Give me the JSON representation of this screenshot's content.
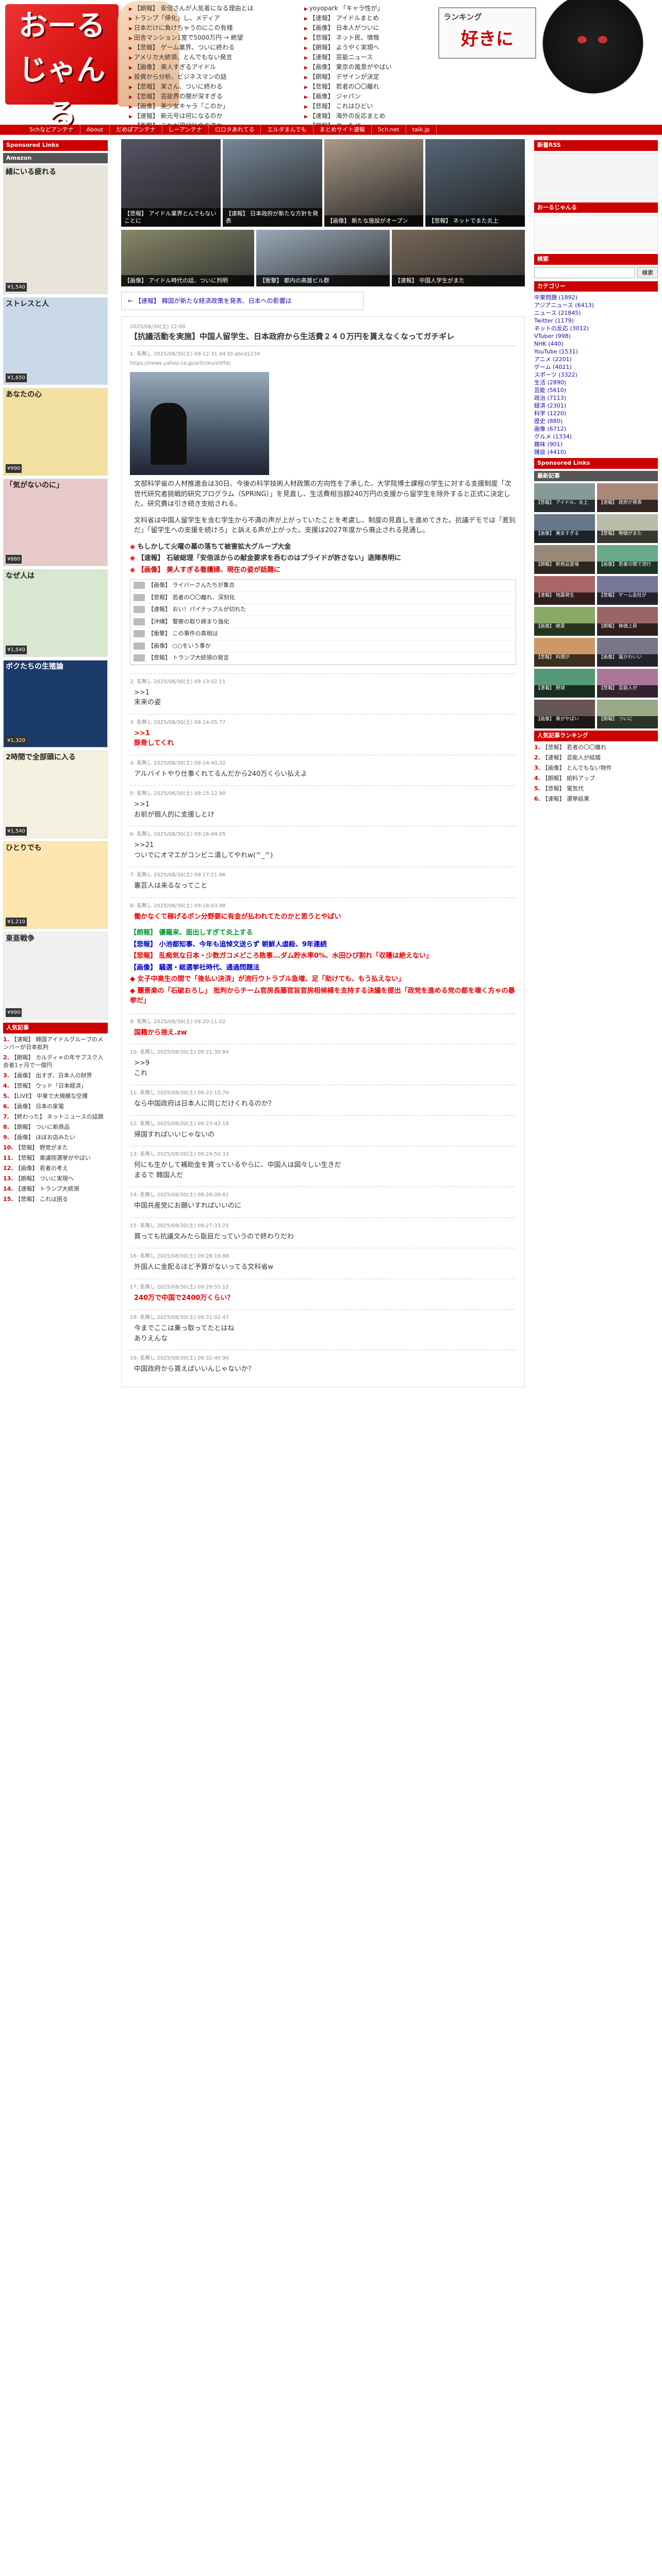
{
  "site": {
    "logo_line1": "おーる",
    "logo_line2": "じゃんる",
    "banner_title": "ランキング",
    "banner_sub": "好きに",
    "headlines": [
      "【朗報】 安倍さんが人気者になる理由とは",
      "トランプ「帰化」し、メディア",
      "日本だけに負けちゃうのにこの有様",
      "田舎マンション1室で5000万円 → 絶望",
      "【悲報】 ゲーム業界、ついに終わる",
      "アメリカ大統領、とんでもない発言",
      "【画像】 美人すぎるアイドル",
      "投資から分析、ビジネスマンの話",
      "【悲報】 某さん、ついに終わる",
      "【悲報】 芸能界の闇が深すぎる",
      "【画像】 美少女キャラ「このか」",
      "【速報】 新元号は何になるのか",
      "【衝撃】 これが現代社会の姿か"
    ],
    "headlines2": [
      "yoyopark 「キャラ性が」",
      "【速報】 アイドルまとめ",
      "【画像】 日本人がついに",
      "【悲報】 ネット民、憤慨",
      "【朗報】 ようやく実現へ",
      "【速報】 芸能ニュース",
      "【画像】 東京の風景がやばい",
      "【朗報】 デザインが決定",
      "【悲報】 若者の〇〇離れ",
      "【画像】 ジャパン",
      "【悲報】 これはひどい",
      "【速報】 海外の反応まとめ",
      "【朗報】 やったぜ"
    ],
    "nav": [
      "5chなどアンテナ",
      "About",
      "だめぽアンテナ",
      "しーアンテナ",
      "ロロタあれてる",
      "エルダまんでも",
      "まとめサイト速報",
      "5ch.net",
      "talk.jp"
    ]
  },
  "left": {
    "ads_heading": "Sponsored Links",
    "amazon_heading": "Amazon",
    "ads": [
      {
        "title": "緒にいる疲れる",
        "price": "¥1,540"
      },
      {
        "title": "ストレスと人",
        "price": "¥1,650"
      },
      {
        "title": "あなたの心",
        "price": "¥990"
      },
      {
        "title": "「気がないのに」",
        "price": "¥880"
      },
      {
        "title": "なぜ人は",
        "price": "¥1,540"
      },
      {
        "title": "ボクたちの生殖論",
        "price": "¥1,320"
      },
      {
        "title": "2時間で全部頭に入る",
        "price": "¥1,540"
      },
      {
        "title": "ひとりでも",
        "price": "¥1,210"
      },
      {
        "title": "東亜戦争",
        "price": "¥990"
      }
    ],
    "ranking_heading": "人気記事",
    "ranking": [
      "【速報】 韓国アイドルグループのメンバーが日本批判",
      "【朗報】 カルディャの年サブスク入会者1ヶ月で一億円",
      "【画像】 出すぎ、日本人の財界",
      "【悲報】 ウッド「日本経済」",
      "【LIVE】 中東で大規模な空爆",
      "【画像】 日本の家電",
      "【終わった】 ネットニュースの話題",
      "【朗報】 ついに新商品",
      "【画像】 ほぼお店みたい",
      "【悲報】 野党がまた",
      "【悲報】 衆議院選挙がやばい",
      "【画像】 若者の考え",
      "【朗報】 ついに実現へ",
      "【速報】 トランプ大統領",
      "【悲報】 これは困る"
    ]
  },
  "main": {
    "features": [
      "【悲報】 アイドル業界とんでもないことに",
      "【速報】 日本政府が新たな方針を発表",
      "【画像】 新たな施設がオープン",
      "【悲報】 ネットでまた炎上"
    ],
    "features2": [
      "【画像】 アイドル時代の話、ついに判明",
      "【衝撃】 都内の高層ビル群",
      "【速報】 中国人学生がまた"
    ],
    "prev_link": "← 【速報】 韓国が新たな経済政策を発表、日本への影響は",
    "article": {
      "date": "2025/08/30(土) 12:00",
      "title": "【抗議活動を実施】中国人留学生、日本政府から生活費２４０万円を貰えなくなってガチギレ",
      "op_meta": "1: 名無し 2025/08/30(土) 09:12:31.44 ID:abcd1234",
      "op_url": "https://news.yahoo.co.jp/articles/e0ffdc",
      "op_body1": "文部科学省の人材推進会は30日、今後の科学技術人材政策の方向性を了承した。大学院博士課程の学生に対する支援制度「次世代研究者挑戦的研究プログラム（SPRING）」を見直し、生活費相当額240万円の支援から留学生を除外すると正式に決定した。研究費は引き続き支給される。",
      "op_body2": "文科省は中国人留学生を含む学生から不満の声が上がっていたことを考慮し、制度の見直しを進めてきた。抗議デモでは「差別だ」「留学生への支援を続けろ」と訴える声が上がった。支援は2027年度から廃止される見通し。",
      "related": [
        {
          "mark": "◆",
          "text": "もしかして火曜の墓の落ちて被害拡大グループ大金"
        },
        {
          "mark": "◆",
          "text": "【速報】 石破総理「安倍派からの献金要求を呑むのはプライドが許さない」退陣表明に"
        },
        {
          "mark": "◆",
          "text": "【画像】 美人すぎる看護婦、現在の姿が話題に"
        }
      ],
      "rel_list": [
        "【画像】 ライバーさんたちが集合",
        "【悲報】 若者の〇〇離れ、深刻化",
        "【速報】 おい！パイナップルが切れた",
        "【沖縄】 警察の取り締まり強化",
        "【衝撃】 この事件の真相は",
        "【画像】 ○○をいう事か",
        "【悲報】 トランプ大統領の発言"
      ],
      "responses": [
        {
          "meta": "2: 名無し 2025/08/30(土) 09:13:02.11",
          "body": ">>1\n末来の姿",
          "style": ""
        },
        {
          "meta": "3: 名無し 2025/08/30(土) 09:14:05.77",
          "body": ">>1\n豚骨してくれ",
          "style": "red"
        },
        {
          "meta": "4: 名無し 2025/08/30(土) 09:14:40.32",
          "body": "アルバイトやり仕事くれてるんだから240万くらい払えよ",
          "style": ""
        },
        {
          "meta": "5: 名無し 2025/08/30(土) 09:15:12.90",
          "body": ">>1\nお前が個人的に支援しとけ",
          "style": ""
        },
        {
          "meta": "6: 名無し 2025/08/30(土) 09:16:44.05",
          "body": ">>21\nついでにオマエがコンビニ潰してやれw(^_^)",
          "style": ""
        },
        {
          "meta": "7: 名無し 2025/08/30(土) 09:17:21.66",
          "body": "裏芸人は来るなってこと",
          "style": ""
        },
        {
          "meta": "8: 名無し 2025/08/30(土) 09:18:03.48",
          "body": "働かなくて稼げるボン分野要に有金が払われてたのかと思うとやばい",
          "style": "red"
        }
      ],
      "breaking": [
        {
          "tag": "【朗報】",
          "text": "優羅来、面出しすぎて炎上する",
          "style": "green"
        },
        {
          "tag": "【悲報】",
          "text": "小池都知事、今年も追悼文送らず 朝鮮人虐殺、9年連続",
          "style": "blue"
        },
        {
          "tag": "【悲報】",
          "text": "乱痴気な日本・少数ガコメどころ敗事...ダム貯水率0%、水田ひび割れ「収穫は絶えない」",
          "style": "red"
        },
        {
          "tag": "【画像】",
          "text": "騒選・総選挙社時代、通過問題法",
          "style": "blue"
        },
        {
          "tag": "◆",
          "text": "女子中高生の間で「後払い決済」が流行ウトラブル急増、足「助けても、もう払えない」",
          "style": "red"
        },
        {
          "tag": "◆",
          "text": "麗景楽の「石破おろし」 批判からチーム官房長藤官旨官房相候補を支持する決議を提出「政党を進める党の都を壊く方ゃの暴挙だ」",
          "style": "red"
        }
      ],
      "responses2": [
        {
          "meta": "9: 名無し 2025/08/30(土) 09:20:11.02",
          "body": "国籍から捨え.zw",
          "style": "red"
        },
        {
          "meta": "10: 名無し 2025/08/30(土) 09:21:30.84",
          "body": ">>9\nこれ",
          "style": ""
        },
        {
          "meta": "11: 名無し 2025/08/30(土) 09:22:15.70",
          "body": "なら中国政府は日本人に同じだけくれるのか？",
          "style": ""
        },
        {
          "meta": "12: 名無し 2025/08/30(土) 09:23:42.18",
          "body": "帰国すればいいじゃないの",
          "style": ""
        },
        {
          "meta": "13: 名無し 2025/08/30(土) 09:24:50.33",
          "body": "何にも生かして補助金を貰っているやらに、中国人は図々しい生きだ\nまるで 韓国人だ",
          "style": ""
        },
        {
          "meta": "14: 名無し 2025/08/30(土) 09:26:09.61",
          "body": "中国共産党にお願いすればいいのに",
          "style": ""
        },
        {
          "meta": "15: 名無し 2025/08/30(土) 09:27:33.25",
          "body": "貰っても抗議文みたら翫目だっていうので終わりだわ",
          "style": ""
        },
        {
          "meta": "16: 名無し 2025/08/30(土) 09:28:19.88",
          "body": "外国人に金配るほど予算がないってる文科省w",
          "style": ""
        },
        {
          "meta": "17: 名無し 2025/08/30(土) 09:29:55.12",
          "body": "240万で中国で2400万くらい？",
          "style": "red"
        },
        {
          "meta": "18: 名無し 2025/08/30(土) 09:31:02.47",
          "body": "今までここは乗っ取ってたとはね\nありえんな",
          "style": ""
        },
        {
          "meta": "19: 名無し 2025/08/30(土) 09:32:40.90",
          "body": "中国政府から貰えばいいんじゃないか？",
          "style": ""
        }
      ]
    }
  },
  "right": {
    "rss_heading": "新着RSS",
    "profile_heading": "おーるじゃんる",
    "search_heading": "検索",
    "search_placeholder": "",
    "search_button": "検索",
    "archive_heading": "カテゴリー",
    "categories": [
      "中東問題 (1892)",
      "アジアニュース (6413)",
      "ニュース (21845)",
      "Twitter (1179)",
      "ネットの反応 (3012)",
      "VTuber (998)",
      "NHK (440)",
      "YouTube (1531)",
      "アニメ (2201)",
      "ゲーム (4021)",
      "スポーツ (3322)",
      "生活 (2890)",
      "芸能 (5610)",
      "政治 (7113)",
      "経済 (2301)",
      "科学 (1220)",
      "歴史 (880)",
      "画像 (6712)",
      "グルメ (1334)",
      "趣味 (901)",
      "雑談 (4410)"
    ],
    "sponsored_heading": "Sponsored Links",
    "latest_heading": "最新記事",
    "thumbs": [
      "【悲報】 アイドル、炎上",
      "【速報】 政府が発表",
      "【画像】 美女すぎる",
      "【悲報】 物価がまた",
      "【朗報】 新商品登場",
      "【画像】 若者の間で流行",
      "【速報】 地震発生",
      "【悲報】 ゲーム会社が",
      "【画像】 絶景",
      "【朗報】 株価上昇",
      "【悲報】 料理が",
      "【画像】 猫かわいい",
      "【速報】 野球",
      "【悲報】 芸能人が",
      "【画像】 車がやばい",
      "【朗報】 ついに"
    ],
    "ranking_heading": "人気記事ランキング",
    "ranking": [
      "【悲報】 若者の〇〇離れ",
      "【速報】 芸能人が結婚",
      "【画像】 とんでもない物件",
      "【朗報】 給料アップ",
      "【悲報】 電気代",
      "【速報】 選挙結果"
    ]
  }
}
